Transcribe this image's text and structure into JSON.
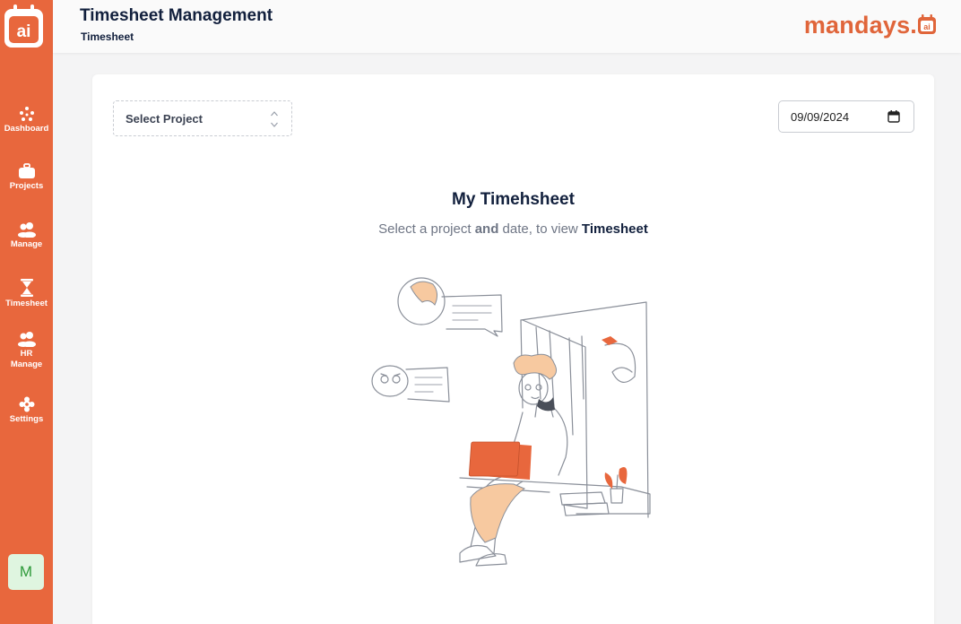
{
  "sidebar": {
    "logo_text": "ai",
    "items": [
      {
        "label": "Dashboard",
        "icon": "dashboard-icon"
      },
      {
        "label": "Projects",
        "icon": "briefcase-icon"
      },
      {
        "label": "Manage",
        "icon": "users-icon"
      },
      {
        "label": "Timesheet",
        "icon": "hourglass-icon"
      },
      {
        "label": "HR\nManage",
        "icon": "hr-users-icon"
      },
      {
        "label": "Settings",
        "icon": "gear-icon"
      }
    ],
    "avatar_initial": "M"
  },
  "header": {
    "title": "Timesheet Management",
    "subtitle": "Timesheet",
    "brand": "mandays.",
    "brand_badge": "ai"
  },
  "main": {
    "project_select": {
      "value": "Select Project"
    },
    "date_input": {
      "value": "09/09/2024"
    },
    "heading": "My Timehsheet",
    "hint": {
      "part1": "Select a project ",
      "bold1": "and",
      "part2": " date, to view ",
      "bold2": "Timesheet"
    }
  },
  "colors": {
    "accent": "#e8673d",
    "navy": "#12203d",
    "background": "#f4f4f5"
  }
}
